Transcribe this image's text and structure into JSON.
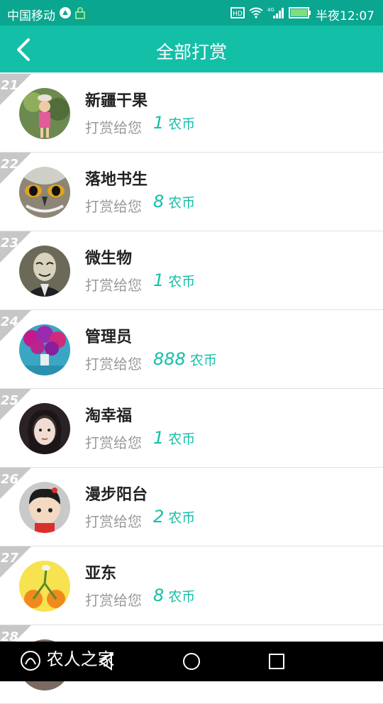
{
  "status": {
    "carrier": "中国移动",
    "time": "半夜12:07",
    "network": "4G",
    "hd": "HD"
  },
  "header": {
    "title": "全部打赏"
  },
  "list": {
    "items": [
      {
        "rank": "21",
        "name": "新疆干果",
        "label": "打赏给您",
        "amount": "1",
        "unit": "农币"
      },
      {
        "rank": "22",
        "name": "落地书生",
        "label": "打赏给您",
        "amount": "8",
        "unit": "农币"
      },
      {
        "rank": "23",
        "name": "微生物",
        "label": "打赏给您",
        "amount": "1",
        "unit": "农币"
      },
      {
        "rank": "24",
        "name": "管理员",
        "label": "打赏给您",
        "amount": "888",
        "unit": "农币"
      },
      {
        "rank": "25",
        "name": "淘幸福",
        "label": "打赏给您",
        "amount": "1",
        "unit": "农币"
      },
      {
        "rank": "26",
        "name": "漫步阳台",
        "label": "打赏给您",
        "amount": "2",
        "unit": "农币"
      },
      {
        "rank": "27",
        "name": "亚东",
        "label": "打赏给您",
        "amount": "8",
        "unit": "农币"
      },
      {
        "rank": "28",
        "name": "",
        "label": "",
        "amount": "",
        "unit": ""
      }
    ]
  },
  "watermark": {
    "text": "农人之家"
  }
}
